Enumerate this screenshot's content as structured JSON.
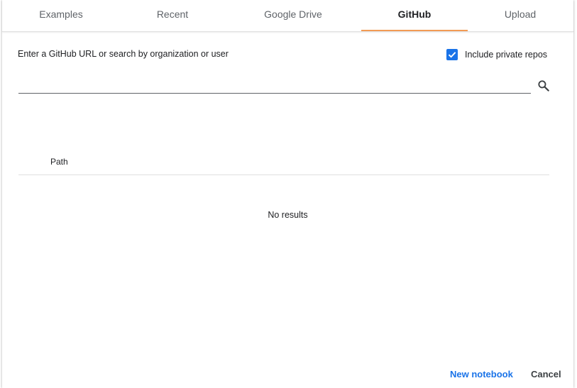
{
  "tabs": [
    {
      "label": "Examples"
    },
    {
      "label": "Recent"
    },
    {
      "label": "Google Drive"
    },
    {
      "label": "GitHub"
    },
    {
      "label": "Upload"
    }
  ],
  "active_tab": "GitHub",
  "github": {
    "prompt": "Enter a GitHub URL or search by organization or user",
    "include_private_label": "Include private repos",
    "include_private_checked": true,
    "search_value": "",
    "search_placeholder": ""
  },
  "results": {
    "columns": [
      "Path"
    ],
    "empty_message": "No results"
  },
  "footer": {
    "new_notebook_label": "New notebook",
    "cancel_label": "Cancel"
  },
  "colors": {
    "accent_blue": "#1a73e8",
    "active_tab_underline": "#f29b55",
    "text_primary": "#202124",
    "text_secondary": "#5f6368"
  },
  "icons": {
    "search": "search-icon",
    "checkbox": "checkmark-icon"
  }
}
